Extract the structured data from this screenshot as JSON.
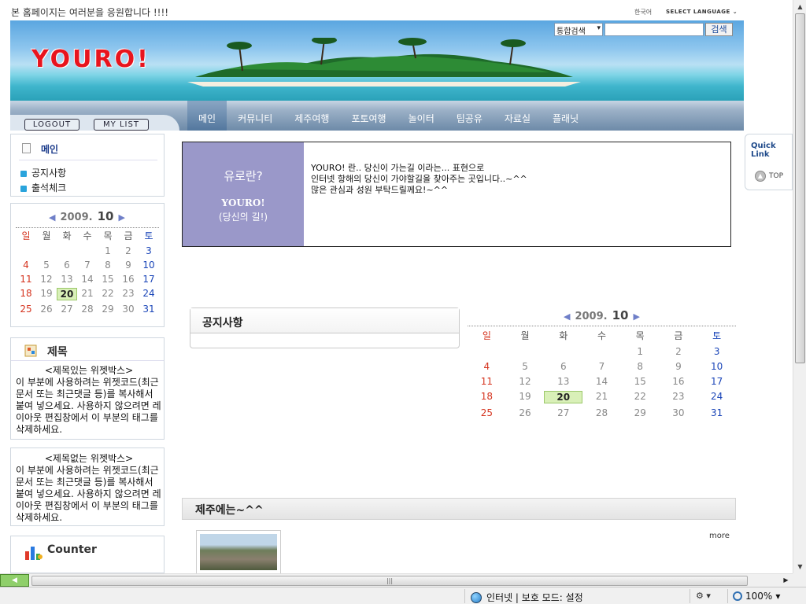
{
  "top": {
    "message": "본 홈페이지는 여러분을 응원합니다 !!!!",
    "language_kr": "한국어",
    "language_select": "SELECT LANGUAGE"
  },
  "header": {
    "logo": "YOURO!",
    "search_scope": "통합검색",
    "search_placeholder": "",
    "search_button": "검색"
  },
  "userbar": {
    "logout": "LOGOUT",
    "mylist": "MY LIST"
  },
  "nav": {
    "items": [
      "메인",
      "커뮤니티",
      "제주여행",
      "포토여행",
      "놀이터",
      "팁공유",
      "자료실",
      "플래닛"
    ],
    "active_index": 0
  },
  "sidebar": {
    "menu_title": "메인",
    "menu_items": [
      "공지사항",
      "출석체크"
    ],
    "calendar": {
      "year": "2009.",
      "month": "10",
      "prev": "◀",
      "next": "▶",
      "weekdays": [
        "일",
        "월",
        "화",
        "수",
        "목",
        "금",
        "토"
      ],
      "days": [
        "",
        "",
        "",
        "",
        "1",
        "2",
        "3",
        "4",
        "5",
        "6",
        "7",
        "8",
        "9",
        "10",
        "11",
        "12",
        "13",
        "14",
        "15",
        "16",
        "17",
        "18",
        "19",
        "20",
        "21",
        "22",
        "23",
        "24",
        "25",
        "26",
        "27",
        "28",
        "29",
        "30",
        "31"
      ],
      "today": "20"
    },
    "widget1": {
      "title": "제목",
      "heading": "<제목있는 위젯박스>",
      "text": "이 부분에 사용하려는 위젯코드(최근문서 또는 최근댓글 등)를 복사해서 붙여 넣으세요. 사용하지 않으려면 레이아웃 편집창에서 이 부분의 태그를 삭제하세요."
    },
    "widget2": {
      "heading": "<제목없는 위젯박스>",
      "text": "이 부분에 사용하려는 위젯코드(최근문서 또는 최근댓글 등)를 복사해서 붙여 넣으세요. 사용하지 않으려면 레이아웃 편집창에서 이 부분의 태그를 삭제하세요."
    },
    "counter_title": "Counter"
  },
  "intro": {
    "title": "유로란?",
    "brand": "YOURO!",
    "tagline": "(당신의 길!)",
    "lines": [
      "YOURO! 란.. 당신이 가는길 이라는... 표현으로",
      "인터넷 항해의 당신이 가야할길을 찾아주는 곳입니다..~^^",
      "많은 관심과 성원 부탁드릴께요!~^^"
    ]
  },
  "notice": {
    "title": "공지사항"
  },
  "main_calendar": {
    "year": "2009.",
    "month": "10",
    "prev": "◀",
    "next": "▶",
    "weekdays": [
      "일",
      "월",
      "화",
      "수",
      "목",
      "금",
      "토"
    ],
    "days": [
      "",
      "",
      "",
      "",
      "1",
      "2",
      "3",
      "4",
      "5",
      "6",
      "7",
      "8",
      "9",
      "10",
      "11",
      "12",
      "13",
      "14",
      "15",
      "16",
      "17",
      "18",
      "19",
      "20",
      "21",
      "22",
      "23",
      "24",
      "25",
      "26",
      "27",
      "28",
      "29",
      "30",
      "31"
    ],
    "today": "20"
  },
  "jeju": {
    "title": "제주에는~^^",
    "more": "more"
  },
  "quick": {
    "label": "Quick Link",
    "top": "TOP"
  },
  "statusbar": {
    "zone": "인터넷 | 보호 모드: 설정",
    "zoom": "100%"
  },
  "colors": {
    "accent_red": "#e8141e",
    "sunday": "#d5341f",
    "saturday": "#1a45b8",
    "intro_bg": "#9a98c9"
  }
}
